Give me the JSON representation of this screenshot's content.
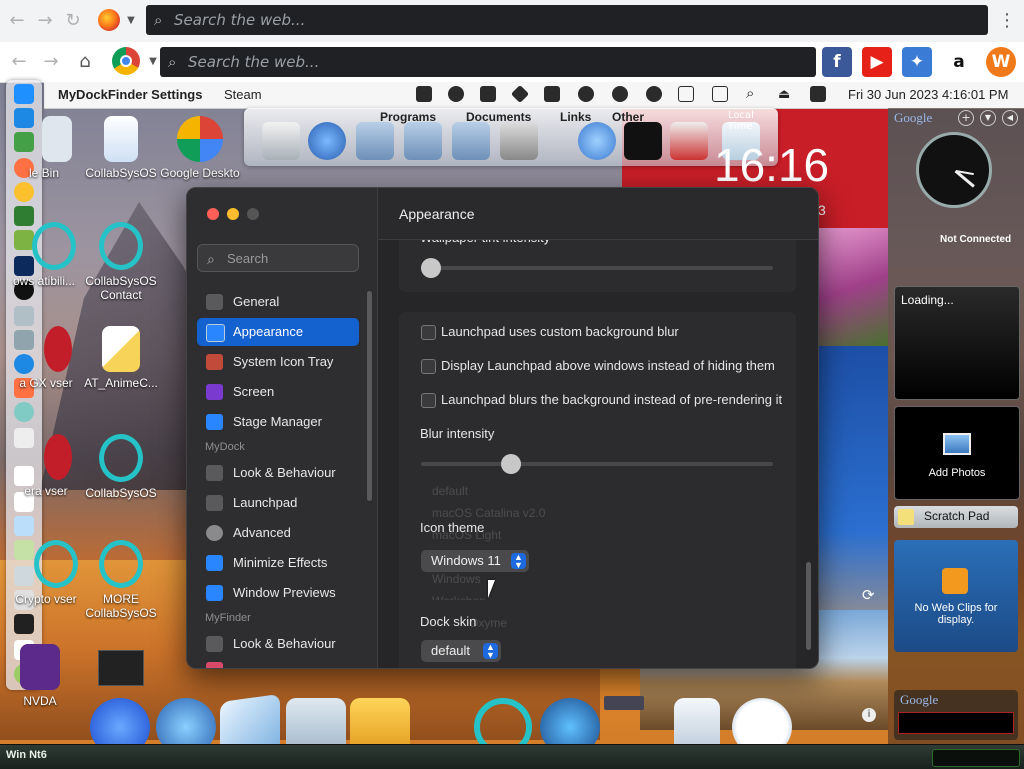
{
  "browser": {
    "search_placeholder_top": "Search the web...",
    "search_placeholder_main": "Search the web...",
    "sites": [
      "facebook",
      "youtube",
      "games",
      "amazon",
      "w"
    ]
  },
  "menubar": {
    "app_name": "MyDockFinder Settings",
    "menu_steam": "Steam",
    "clock": "Fri 30 Jun 2023  4:16:01 PM"
  },
  "shelf": {
    "tabs": [
      "Programs",
      "Documents",
      "Links",
      "Other"
    ],
    "clock_label": "Local Time",
    "clock_time": "16:16",
    "date_fragment": "3"
  },
  "desktop_icons": [
    {
      "label": "le Bin"
    },
    {
      "label": "CollabSysOS"
    },
    {
      "label": "Google Deskto"
    },
    {
      "label": "ows atibili..."
    },
    {
      "label": "CollabSysOS Contact"
    },
    {
      "label": "a GX vser"
    },
    {
      "label": "AT_AnimeC..."
    },
    {
      "label": "era vser"
    },
    {
      "label": "CollabSysOS"
    },
    {
      "label": "Crypto vser"
    },
    {
      "label": "MORE CollabSysOS"
    },
    {
      "label": "NVDA"
    }
  ],
  "gadgets": {
    "google1": "Google",
    "not_connected": "Not Connected",
    "loading": "Loading...",
    "add_photos": "Add Photos",
    "scratch_pad": "Scratch Pad",
    "no_web_clips": "No Web Clips for display.",
    "google2": "Google"
  },
  "settings": {
    "search_placeholder": "Search",
    "title": "Appearance",
    "nav": [
      {
        "label": "General",
        "color": "#5a5a5c"
      },
      {
        "label": "Appearance",
        "color": "#2a86ff",
        "selected": true
      },
      {
        "label": "System Icon Tray",
        "color": "#c24a3a"
      },
      {
        "label": "Screen",
        "color": "#7a3ad0"
      },
      {
        "label": "Stage Manager",
        "color": "#2a86ff"
      }
    ],
    "section_mydock": "MyDock",
    "nav_mydock": [
      {
        "label": "Look & Behaviour",
        "color": "#5a5a5c"
      },
      {
        "label": "Launchpad",
        "color": "#5a5a5c"
      },
      {
        "label": "Advanced",
        "color": "#8a8a8c"
      },
      {
        "label": "Minimize Effects",
        "color": "#2a86ff"
      },
      {
        "label": "Window Previews",
        "color": "#2a86ff"
      }
    ],
    "section_myfinder": "MyFinder",
    "nav_myfinder": [
      {
        "label": "Look & Behaviour",
        "color": "#5a5a5c"
      }
    ],
    "wallpaper_tint_label": "Wallpaper tint intensity",
    "wallpaper_tint_value": 0.0,
    "checkbox_1": "Launchpad uses custom background blur",
    "checkbox_2": "Display Launchpad above windows instead of hiding them",
    "checkbox_3": "Launchpad blurs the background instead of pre-rendering it",
    "blur_label": "Blur intensity",
    "blur_value": 0.24,
    "icon_theme_label": "Icon theme",
    "icon_theme_value": "Windows 11",
    "dock_skin_label": "Dock skin",
    "dock_skin_value": "default",
    "ghost_options": [
      "default",
      "macOS Catalina v2.0",
      "macOS Light",
      "Windows 11",
      "Windows",
      "Workshop",
      "Oxyme"
    ]
  },
  "taskbar": {
    "start_text": "Win Nt6"
  },
  "colors": {
    "accent": "#1461d0",
    "window_bg": "#2a2a2c",
    "browser_dark_search": "#202124"
  }
}
